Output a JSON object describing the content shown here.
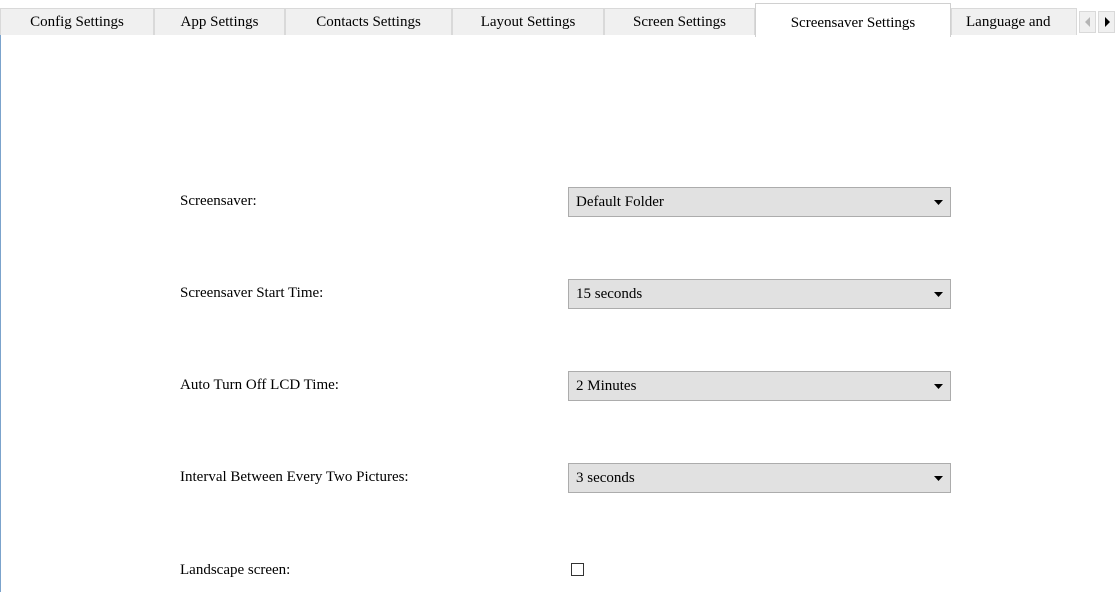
{
  "tabs": [
    {
      "label": "Config Settings",
      "active": false
    },
    {
      "label": "App Settings",
      "active": false
    },
    {
      "label": "Contacts Settings",
      "active": false
    },
    {
      "label": "Layout Settings",
      "active": false
    },
    {
      "label": "Screen Settings",
      "active": false
    },
    {
      "label": "Screensaver Settings",
      "active": true
    },
    {
      "label": "Language and",
      "active": false
    }
  ],
  "tab_scroll": {
    "left_icon": "triangle-left-icon",
    "right_icon": "triangle-right-icon"
  },
  "form": {
    "screensaver": {
      "label": "Screensaver:",
      "value": "Default Folder"
    },
    "start_time": {
      "label": "Screensaver Start Time:",
      "value": "15 seconds"
    },
    "lcd_off": {
      "label": "Auto Turn Off LCD Time:",
      "value": "2 Minutes"
    },
    "interval": {
      "label": "Interval Between Every Two Pictures:",
      "value": "3 seconds"
    },
    "landscape": {
      "label": "Landscape screen:",
      "checked": false
    }
  },
  "colors": {
    "panel_border": "#7ba3cc",
    "select_background": "#e1e1e1",
    "tab_background": "#f0f0f0"
  }
}
